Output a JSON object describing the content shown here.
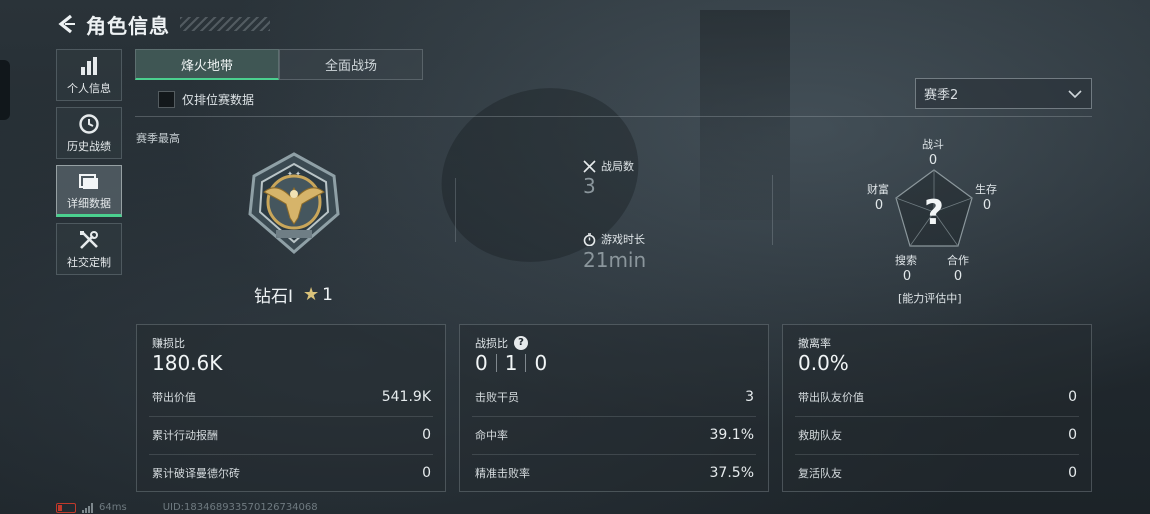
{
  "header": {
    "title": "角色信息"
  },
  "nav": {
    "items": [
      {
        "label": "个人信息",
        "icon": "bar-chart-icon"
      },
      {
        "label": "历史战绩",
        "icon": "history-icon"
      },
      {
        "label": "详细数据",
        "icon": "folder-icon",
        "active": true
      },
      {
        "label": "社交定制",
        "icon": "tools-icon"
      }
    ]
  },
  "tabs": [
    {
      "label": "烽火地带",
      "active": true
    },
    {
      "label": "全面战场",
      "active": false
    }
  ],
  "filter": {
    "ranked_only_label": "仅排位赛数据",
    "checked": false
  },
  "season_select": {
    "value": "赛季2"
  },
  "season_best": {
    "label": "赛季最高",
    "rank_name": "钻石I",
    "stars": "1"
  },
  "match_stats": {
    "matches_label": "战局数",
    "matches_value": "3",
    "playtime_label": "游戏时长",
    "playtime_value": "21min"
  },
  "radar": {
    "combat_label": "战斗",
    "combat_value": "0",
    "survival_label": "生存",
    "survival_value": "0",
    "teamwork_label": "合作",
    "teamwork_value": "0",
    "search_label": "搜索",
    "search_value": "0",
    "wealth_label": "财富",
    "wealth_value": "0",
    "center_mark": "?",
    "status": "[能力评估中]"
  },
  "cards": {
    "profit": {
      "title": "赚损比",
      "value": "180.6K",
      "rows": [
        {
          "label": "带出价值",
          "value": "541.9K"
        },
        {
          "label": "累计行动报酬",
          "value": "0"
        },
        {
          "label": "累计破译曼德尔砖",
          "value": "0"
        }
      ]
    },
    "kd": {
      "title": "战损比",
      "help": "?",
      "values": [
        "0",
        "1",
        "0"
      ],
      "rows": [
        {
          "label": "击败干员",
          "value": "3"
        },
        {
          "label": "命中率",
          "value": "39.1%"
        },
        {
          "label": "精准击败率",
          "value": "37.5%"
        }
      ]
    },
    "extract": {
      "title": "撤离率",
      "value": "0.0%",
      "rows": [
        {
          "label": "带出队友价值",
          "value": "0"
        },
        {
          "label": "救助队友",
          "value": "0"
        },
        {
          "label": "复活队友",
          "value": "0"
        }
      ]
    }
  },
  "status_bar": {
    "ping": "64ms",
    "uid": "UID:183468933570126734068"
  },
  "colors": {
    "accent": "#4bd08f",
    "badge_gold": "#d9c27a"
  }
}
